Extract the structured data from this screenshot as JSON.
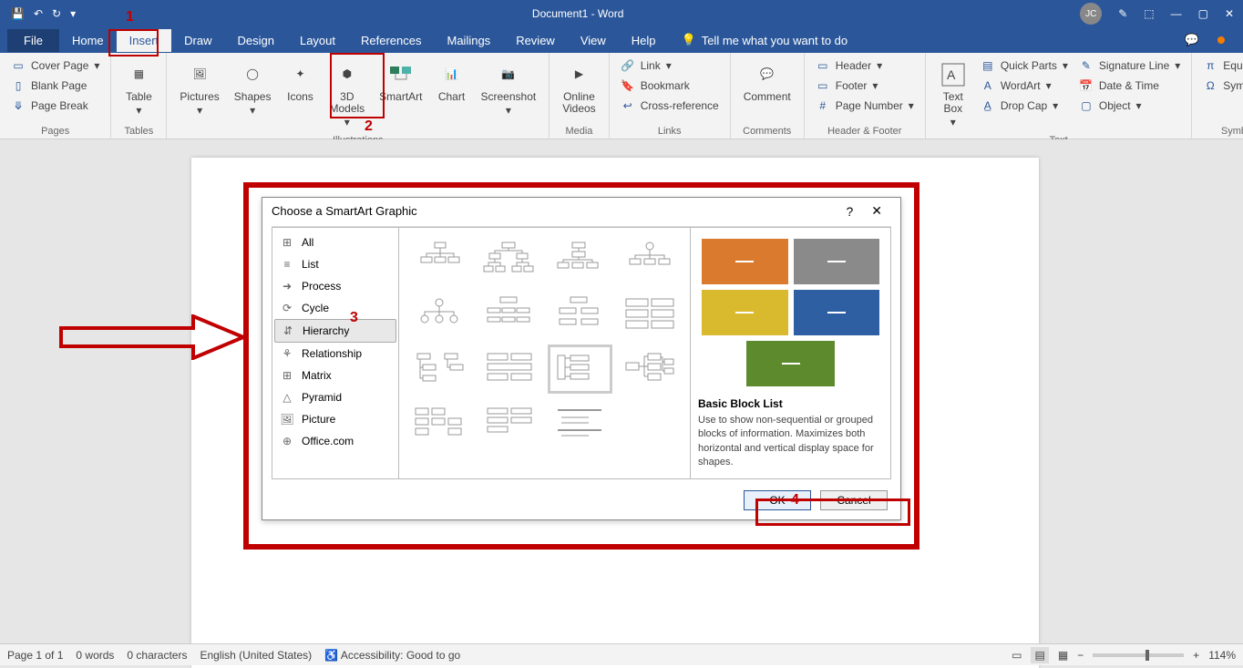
{
  "title": "Document1 - Word",
  "avatar": "JC",
  "menubar": [
    "File",
    "Home",
    "Insert",
    "Draw",
    "Design",
    "Layout",
    "References",
    "Mailings",
    "Review",
    "View",
    "Help"
  ],
  "tellme": "Tell me what you want to do",
  "ribbon": {
    "pages": {
      "label": "Pages",
      "cover": "Cover Page",
      "blank": "Blank Page",
      "break": "Page Break"
    },
    "tables": {
      "label": "Tables",
      "table": "Table"
    },
    "illus": {
      "label": "Illustrations",
      "pictures": "Pictures",
      "shapes": "Shapes",
      "icons": "Icons",
      "models": "3D\nModels",
      "smartart": "SmartArt",
      "chart": "Chart",
      "screenshot": "Screenshot"
    },
    "media": {
      "label": "Media",
      "online": "Online\nVideos"
    },
    "links": {
      "label": "Links",
      "link": "Link",
      "bookmark": "Bookmark",
      "cross": "Cross-reference"
    },
    "comments": {
      "label": "Comments",
      "comment": "Comment"
    },
    "hf": {
      "label": "Header & Footer",
      "header": "Header",
      "footer": "Footer",
      "pagenum": "Page Number"
    },
    "text": {
      "label": "Text",
      "textbox": "Text\nBox",
      "quick": "Quick Parts",
      "wordart": "WordArt",
      "dropcap": "Drop Cap",
      "sig": "Signature Line",
      "date": "Date & Time",
      "object": "Object"
    },
    "symbols": {
      "label": "Symbols",
      "equation": "Equation",
      "symbol": "Symbol"
    }
  },
  "dialog": {
    "title": "Choose a SmartArt Graphic",
    "categories": [
      "All",
      "List",
      "Process",
      "Cycle",
      "Hierarchy",
      "Relationship",
      "Matrix",
      "Pyramid",
      "Picture",
      "Office.com"
    ],
    "preview_title": "Basic Block List",
    "preview_desc": "Use to show non-sequential or grouped blocks of information. Maximizes both horizontal and vertical display space for shapes.",
    "ok": "OK",
    "cancel": "Cancel",
    "colors": [
      "#d97a2e",
      "#8a8a8a",
      "#d9b92e",
      "#2e5fa3",
      "#5e8a2e"
    ]
  },
  "status": {
    "page": "Page 1 of 1",
    "words": "0 words",
    "chars": "0 characters",
    "lang": "English (United States)",
    "access": "Accessibility: Good to go",
    "zoom": "114%"
  },
  "anno": {
    "1": "1",
    "2": "2",
    "3": "3",
    "4": "4"
  }
}
